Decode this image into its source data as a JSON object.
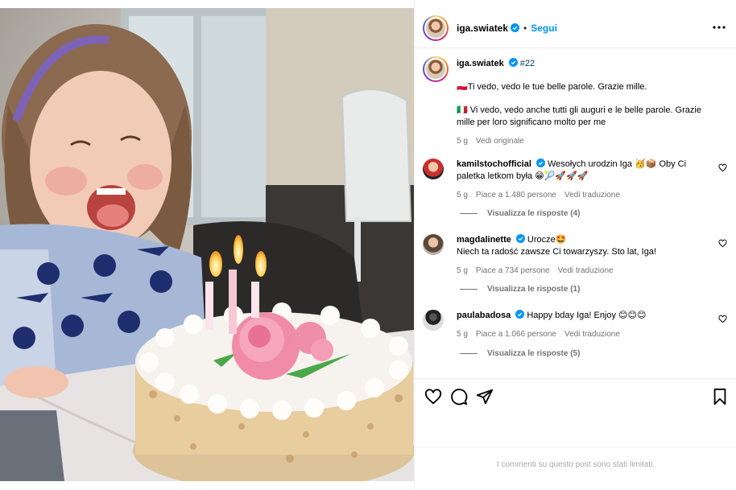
{
  "post": {
    "author": "iga.swiatek",
    "follow_label": "Segui",
    "dot": "•"
  },
  "caption": {
    "hashtag": "#22",
    "line1": "🇵🇱Ti vedo, vedo le tue belle parole. Grazie mille.",
    "line2": "🇮🇹 Vi vedo, vedo anche tutti gli auguri e le belle parole. Grazie mille per loro significano molto per me",
    "time": "5 g",
    "see_original": "Vedi originale"
  },
  "comments": [
    {
      "user": "kamilstochofficial",
      "verified": true,
      "text": "Wesołych urodzin Iga 🥳📦 Oby Ci paletka letkom była 😁🎾🚀🚀🚀",
      "time": "5 g",
      "likes": "Piace a 1.480 persone",
      "translate": "Vedi traduzione",
      "replies": "Visualizza le risposte (4)"
    },
    {
      "user": "magdalinette",
      "verified": true,
      "text": "Urocze🤩\nNiech ta radość zawsze Ci towarzyszy. Sto lat, Iga!",
      "time": "5 g",
      "likes": "Piace a 734 persone",
      "translate": "Vedi traduzione",
      "replies": "Visualizza le risposte (1)"
    },
    {
      "user": "paulabadosa",
      "verified": true,
      "text": "Happy bday Iga! Enjoy 😊😊😊",
      "time": "5 g",
      "likes": "Piace a 1.066 persone",
      "translate": "Vedi traduzione",
      "replies": "Visualizza le risposte (5)"
    }
  ],
  "footer": {
    "limited": "I commenti su questo post sono stati limitati."
  },
  "icons": {
    "like": "heart-icon",
    "comment": "comment-icon",
    "share": "share-icon",
    "save": "bookmark-icon",
    "more": "more-horizontal-icon",
    "verified": "verified-badge-icon"
  },
  "colors": {
    "accent": "#0095f6",
    "verified": "#0095f6",
    "muted": "#737373",
    "hashtag": "#00376b"
  }
}
